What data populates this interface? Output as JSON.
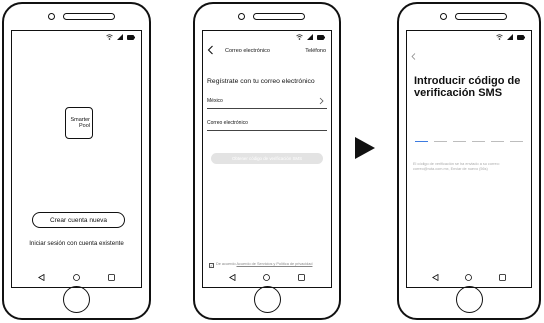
{
  "screens": {
    "welcome": {
      "logo_line1": "Smarter",
      "logo_line2": "Pool",
      "create_account_label": "Crear cuenta nueva",
      "login_label": "Iniciar sesión con cuenta existente"
    },
    "email_signup": {
      "tab_email": "Correo electrónico",
      "tab_phone": "Teléfono",
      "title": "Regístrate con tu correo electrónico",
      "country_value": "México",
      "email_label": "Correo electrónico",
      "get_code_label": "Obtener código de verificación SMS",
      "terms_text": "De acuerdo ",
      "terms_link": "Acuerdo de Servicios y Política de privacidad"
    },
    "sms_verify": {
      "title": "Introducir código de verificación SMS",
      "code_slots": 6,
      "info_text": "El código de verificación se ha enviado a su correo: correo@ruta.com.mx, Enviar de nuevo (56s)"
    }
  },
  "icons": {
    "status": [
      "wifi-icon",
      "signal-icon",
      "battery-icon"
    ],
    "navbar": [
      "back-triangle-icon",
      "home-circle-icon",
      "recents-square-icon"
    ],
    "arrow": "play-arrow-icon"
  },
  "colors": {
    "active_code_slot": "#3d7be0",
    "disabled_button": "#e3e3e3"
  }
}
